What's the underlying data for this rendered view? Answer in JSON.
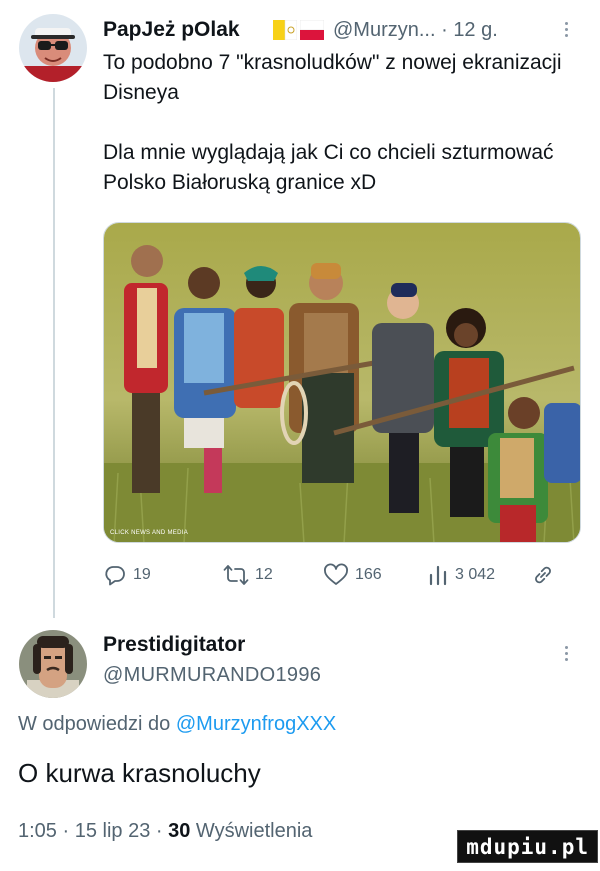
{
  "tweet": {
    "author_name": "PapJeż pOlak",
    "author_handle_meta": "@Murzyn... · 12 g.",
    "text": "To podobno 7 \"krasnoludków\" z nowej ekranizacji Disneya\n\nDla mnie wyglądają jak Ci co chcieli szturmować Polsko Białoruską granice xD",
    "media_caption": "CLICK NEWS AND MEDIA",
    "actions": {
      "replies": "19",
      "retweets": "12",
      "likes": "166",
      "views": "3 042"
    },
    "flags": [
      "Vatican City",
      "Poland"
    ]
  },
  "reply": {
    "author_name": "Prestidigitator",
    "author_handle": "@MURMURANDO1996",
    "replying_prefix": "W odpowiedzi do",
    "replying_mention": "@MurzynfrogXXX",
    "text": "O kurwa krasnoluchy",
    "timestamp": "1:05 · 15 lip 23 ·",
    "views_count": "30",
    "views_label": "Wyświetlenia"
  },
  "watermark": "mdupiu.pl",
  "icons": [
    "reply-icon",
    "retweet-icon",
    "like-icon",
    "views-icon",
    "share-icon",
    "more-icon"
  ]
}
